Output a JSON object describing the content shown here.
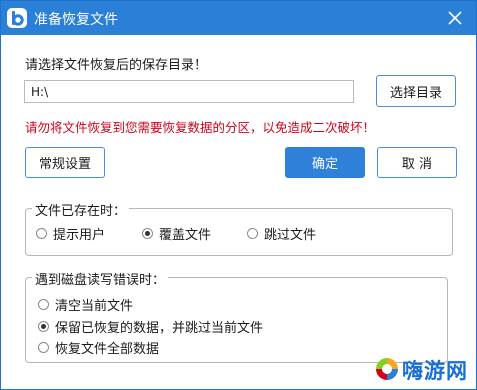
{
  "window": {
    "title": "准备恢复文件",
    "logo_letter": "b",
    "close_symbol": "×"
  },
  "main": {
    "prompt": "请选择文件恢复后的保存目录！",
    "path_value": "H:\\",
    "choose_button": "选择目录",
    "warning": "请勿将文件恢复到您需要恢复数据的分区，以免造成二次破坏！",
    "general_settings_button": "常规设置",
    "ok_button": "确定",
    "cancel_button": "取 消"
  },
  "file_exists_group": {
    "title": "文件已存在时：",
    "options": [
      {
        "label": "提示用户",
        "selected": false
      },
      {
        "label": "覆盖文件",
        "selected": true
      },
      {
        "label": "跳过文件",
        "selected": false
      }
    ]
  },
  "disk_error_group": {
    "title": "遇到磁盘读写错误时：",
    "options": [
      {
        "label": "清空当前文件",
        "selected": false
      },
      {
        "label": "保留已恢复的数据，并跳过当前文件",
        "selected": true
      },
      {
        "label": "恢复文件全部数据",
        "selected": false
      }
    ]
  },
  "watermark": {
    "text": "嗨游网"
  },
  "colors": {
    "titlebar": "#2a7fd6",
    "accent": "#2f80d8",
    "warning": "#d0021b",
    "watermark": "#1a6fd4"
  }
}
